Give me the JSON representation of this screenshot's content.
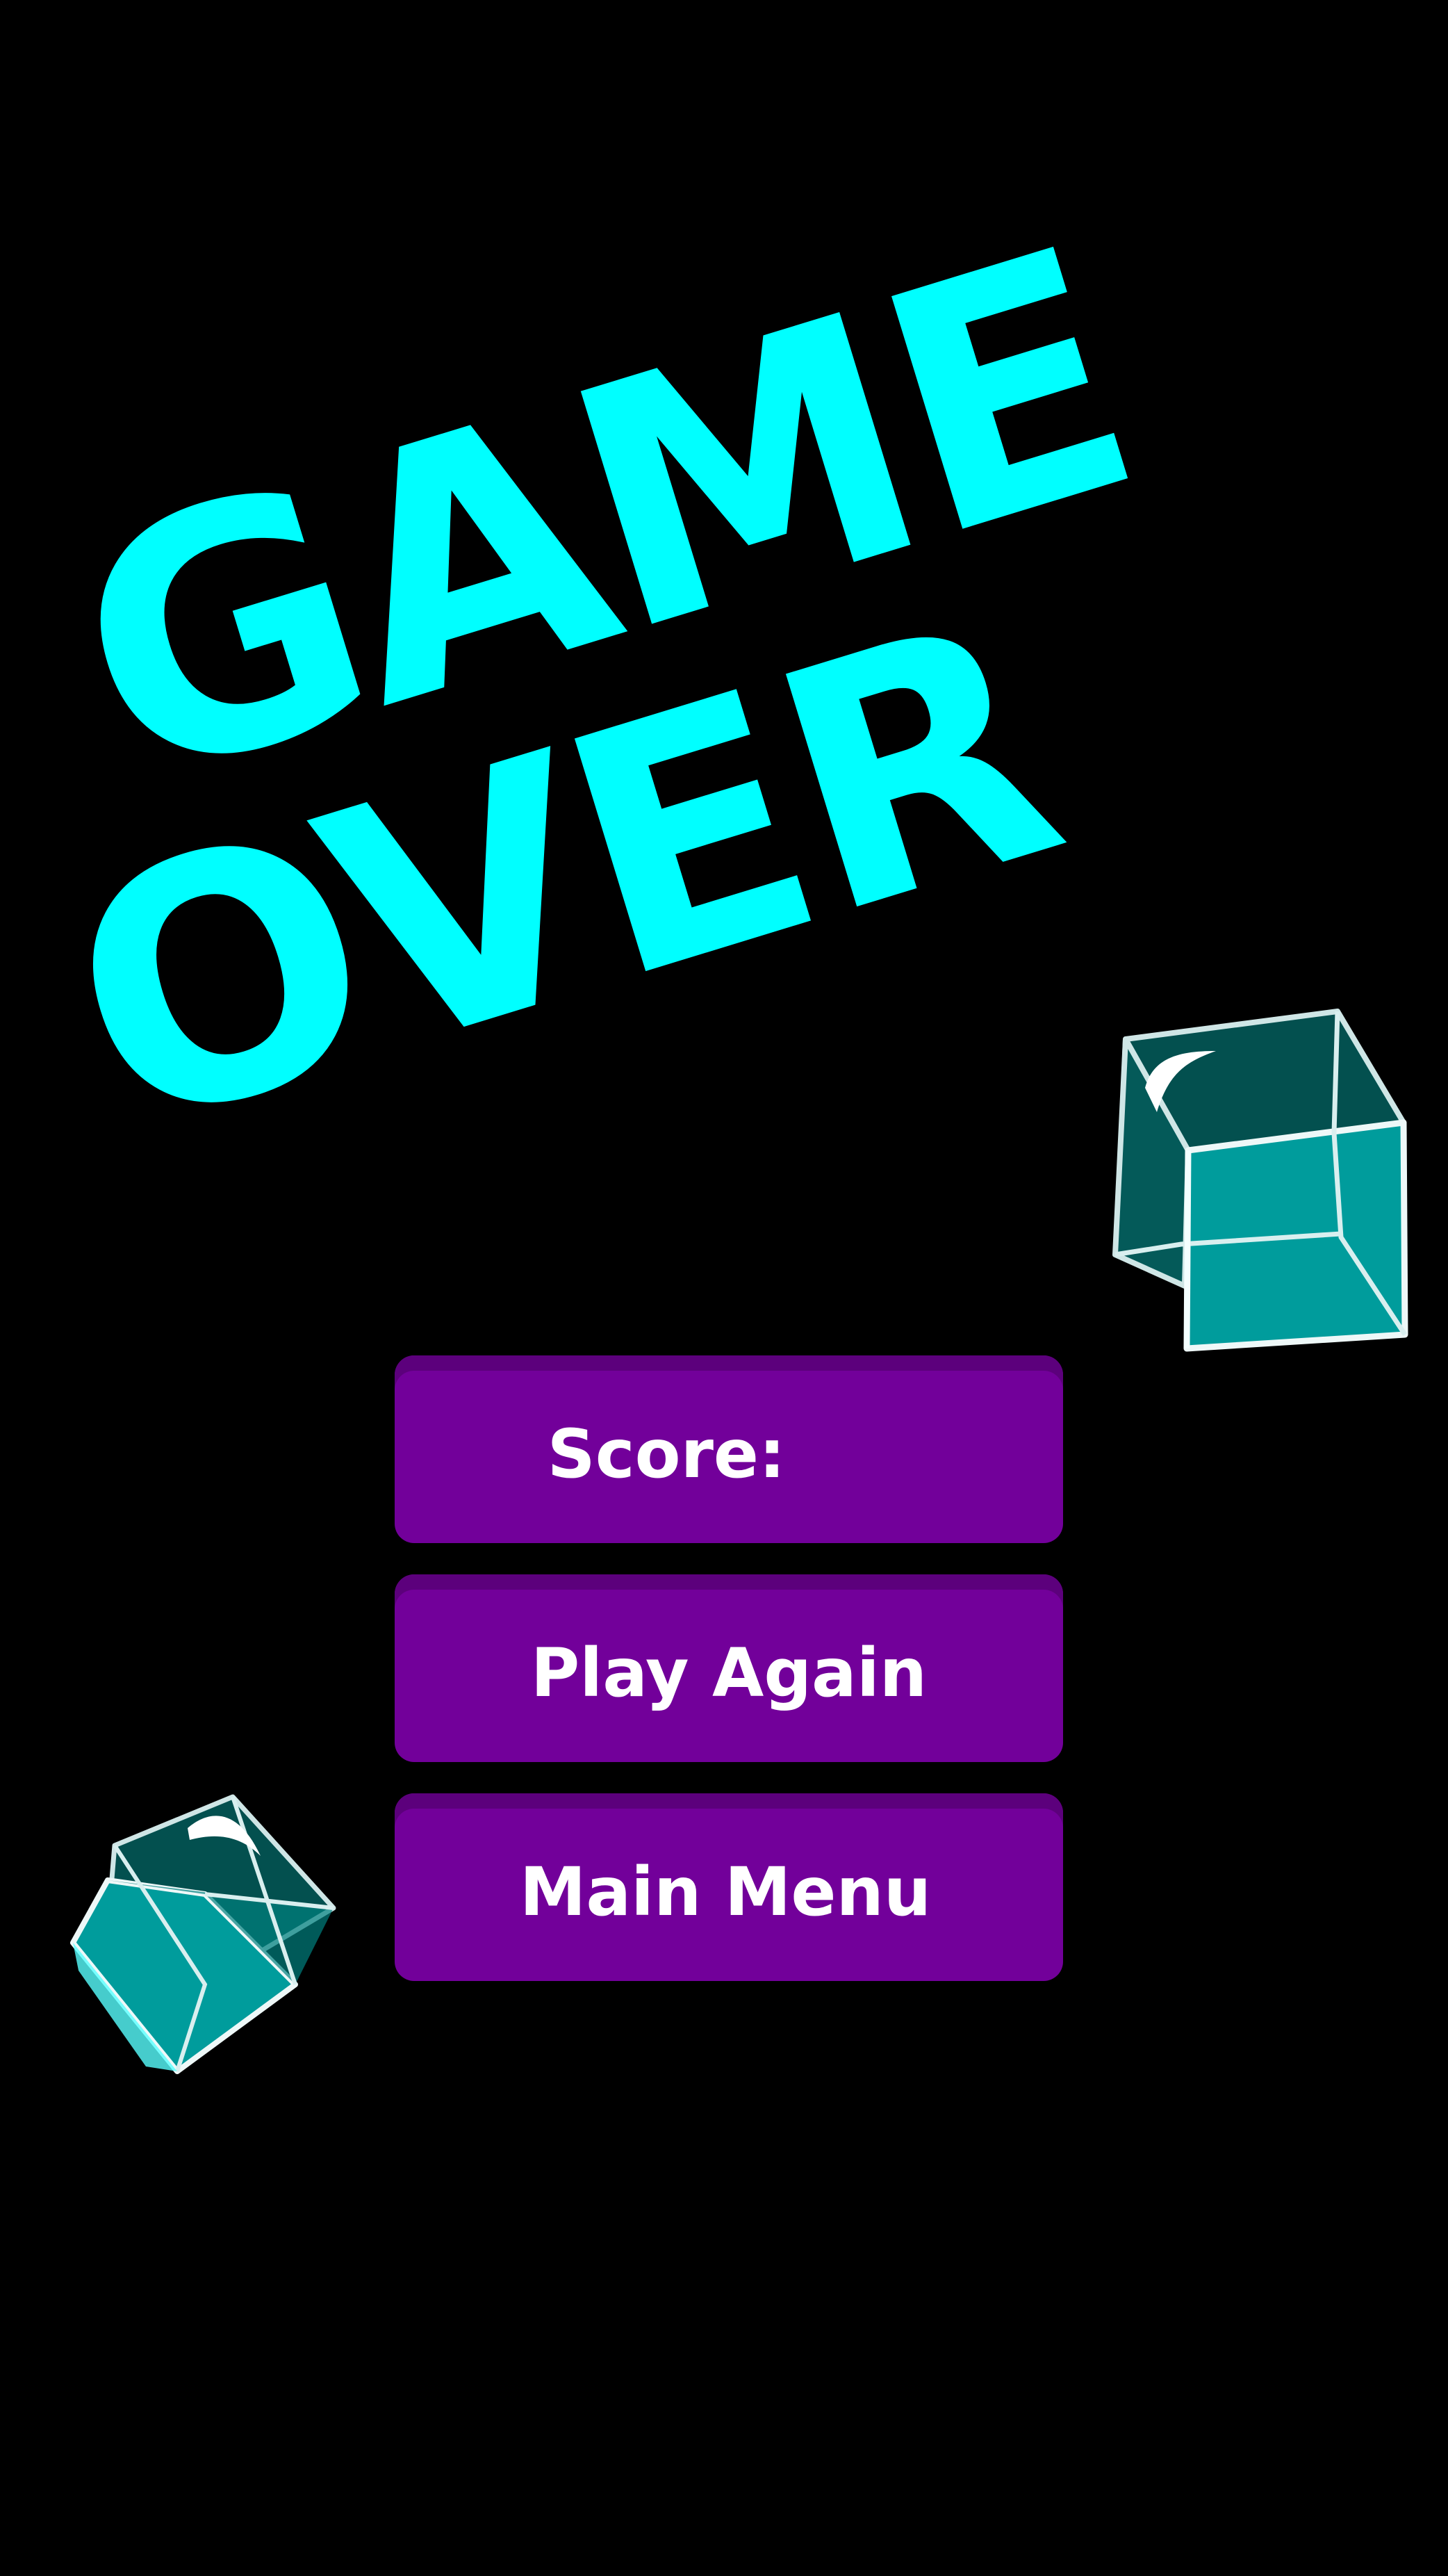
{
  "title": {
    "line1": "GAME",
    "line2": "OVER"
  },
  "buttons": {
    "score_label": "Score:",
    "play_again_label": "Play Again",
    "main_menu_label": "Main Menu"
  },
  "colors": {
    "background": "#000000",
    "title_text": "#00ffff",
    "button_fill": "#72009a",
    "button_top_edge": "#5c007c",
    "button_text": "#ffffff",
    "cube_dark_face": "#03504f",
    "cube_light_face": "#009c9c",
    "cube_edge": "#e6f2f2"
  },
  "decorations": {
    "cubes": [
      "ice-cube-icon",
      "ice-cube-icon"
    ]
  }
}
